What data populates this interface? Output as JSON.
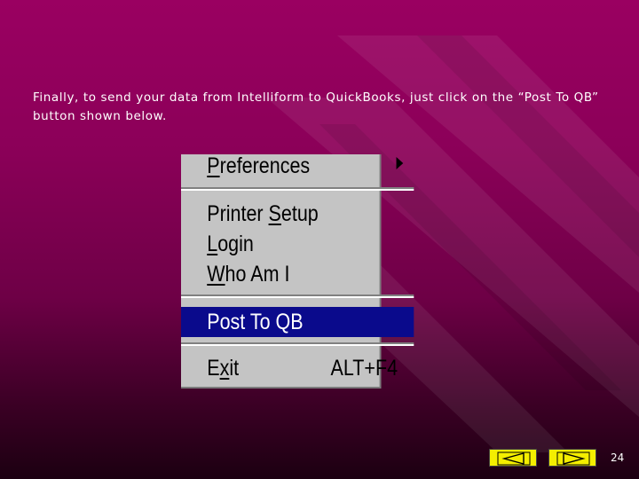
{
  "slide": {
    "caption": "Finally, to send your data from Intelliform to QuickBooks, just click on the “Post To QB” button shown below.",
    "page_number": "24"
  },
  "menu": {
    "items": [
      {
        "pre": "",
        "key": "P",
        "post": "references",
        "has_submenu": true
      },
      {
        "pre": "Printer ",
        "key": "S",
        "post": "etup"
      },
      {
        "pre": "",
        "key": "L",
        "post": "ogin"
      },
      {
        "pre": "",
        "key": "W",
        "post": "ho Am I"
      },
      {
        "pre": "Post To QB",
        "key": "",
        "post": "",
        "highlighted": true
      },
      {
        "pre": "E",
        "key": "x",
        "post": "it",
        "shortcut": "ALT+F4"
      }
    ]
  },
  "nav": {
    "prev_icon": "triangle-left-icon",
    "next_icon": "triangle-right-icon"
  },
  "colors": {
    "background_top": "#9a0061",
    "background_bottom": "#1c0011",
    "menu_bg": "#c4c4c4",
    "menu_highlight": "#0a0a8c",
    "nav_button": "#f4ee00"
  }
}
